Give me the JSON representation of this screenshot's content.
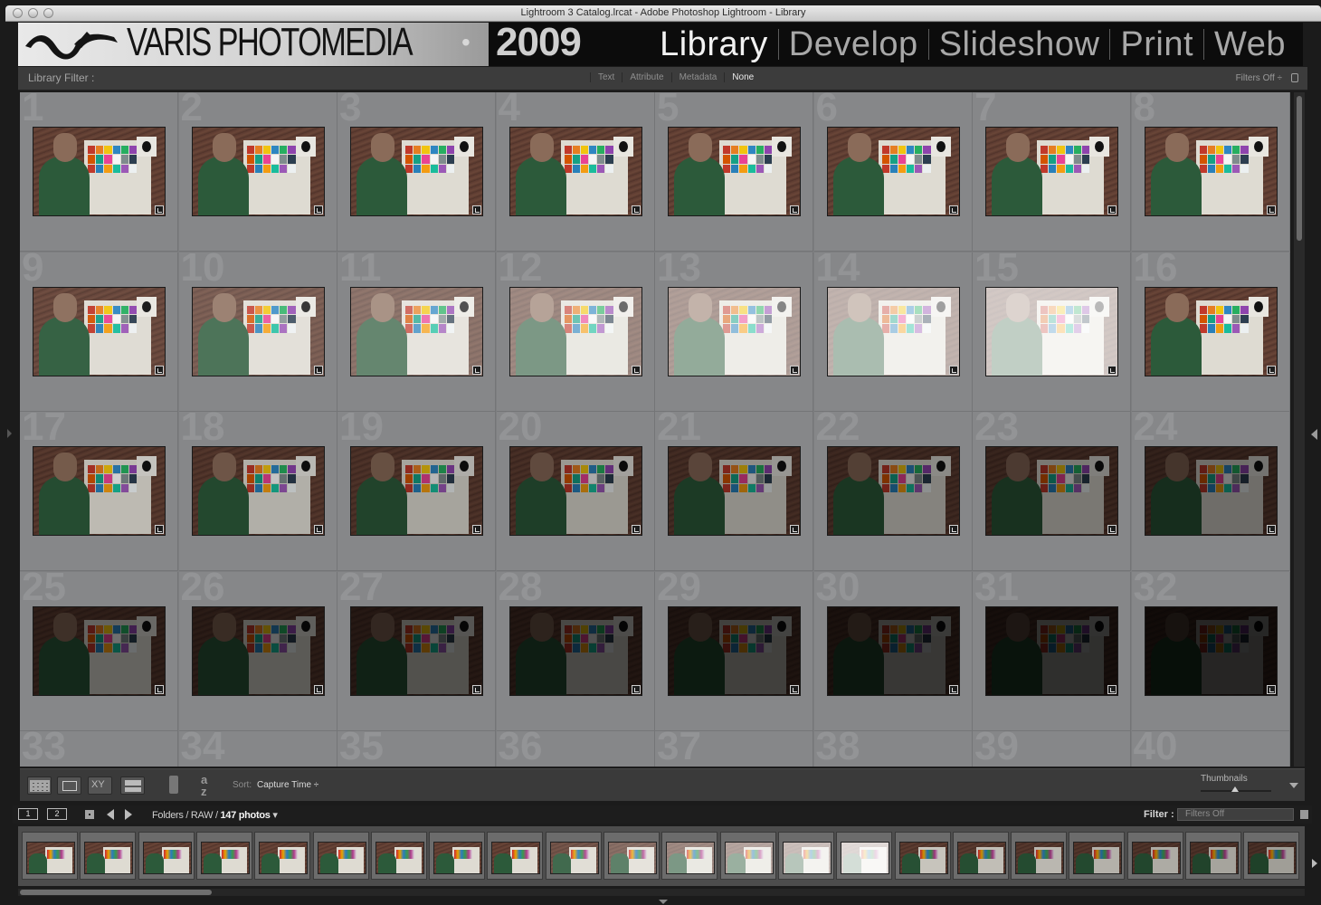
{
  "window": {
    "title": "Lightroom 3 Catalog.lrcat - Adobe Photoshop Lightroom - Library"
  },
  "identity_plate": {
    "brand": "VARIS PHOTOMEDIA",
    "separator": "•",
    "year": "2009",
    "logo_icon": "varis-wave-logo-icon"
  },
  "modules": [
    "Library",
    "Develop",
    "Slideshow",
    "Print",
    "Web"
  ],
  "active_module": "Library",
  "library_filter": {
    "label": "Library Filter :",
    "tabs": [
      "Text",
      "Attribute",
      "Metadata",
      "None"
    ],
    "active_tab": "None",
    "preset": "Filters Off",
    "lock_icon": "lock-icon"
  },
  "grid": {
    "cells": [
      {
        "num": "1"
      },
      {
        "num": "2"
      },
      {
        "num": "3"
      },
      {
        "num": "4"
      },
      {
        "num": "5"
      },
      {
        "num": "6"
      },
      {
        "num": "7"
      },
      {
        "num": "8"
      },
      {
        "num": "9"
      },
      {
        "num": "10"
      },
      {
        "num": "11"
      },
      {
        "num": "12"
      },
      {
        "num": "13"
      },
      {
        "num": "14"
      },
      {
        "num": "15"
      },
      {
        "num": "16"
      },
      {
        "num": "17"
      },
      {
        "num": "18"
      },
      {
        "num": "19"
      },
      {
        "num": "20"
      },
      {
        "num": "21"
      },
      {
        "num": "22"
      },
      {
        "num": "23"
      },
      {
        "num": "24"
      },
      {
        "num": "25"
      },
      {
        "num": "26"
      },
      {
        "num": "27"
      },
      {
        "num": "28"
      },
      {
        "num": "29"
      },
      {
        "num": "30"
      },
      {
        "num": "31"
      },
      {
        "num": "32"
      },
      {
        "num": "33"
      },
      {
        "num": "34"
      },
      {
        "num": "35"
      },
      {
        "num": "36"
      },
      {
        "num": "37"
      },
      {
        "num": "38"
      },
      {
        "num": "39"
      },
      {
        "num": "40"
      }
    ]
  },
  "toolbar": {
    "view_buttons": [
      "grid-view-icon",
      "loupe-view-icon",
      "compare-view-icon",
      "survey-view-icon"
    ],
    "spray_icon": "painter-spray-can-icon",
    "sort_dir_icon": "sort-az-icon",
    "sort_label": "Sort:",
    "sort_value": "Capture Time",
    "thumbnails_label": "Thumbnails"
  },
  "filmstrip": {
    "monitor_1": "1",
    "monitor_2": "2",
    "path_prefix": "Folders / RAW / ",
    "photo_count": "147 photos",
    "filter_label": "Filter :",
    "filter_value": "Filters Off"
  }
}
